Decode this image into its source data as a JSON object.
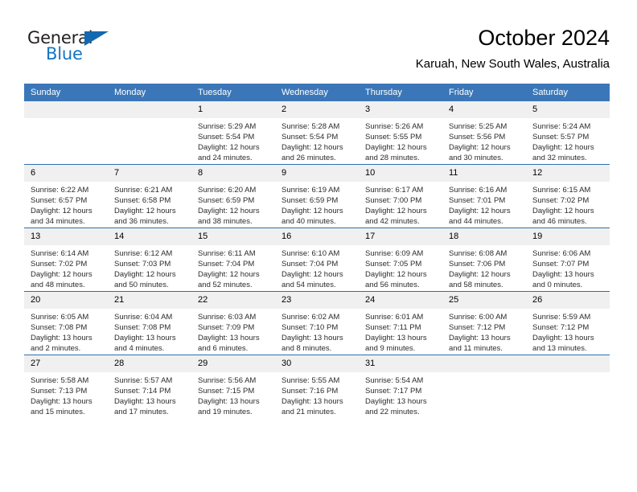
{
  "brand": {
    "name_part1": "General",
    "name_part2": "Blue",
    "triangle_icon": "triangle-icon",
    "accent_color": "#1474c4"
  },
  "header": {
    "title": "October 2024",
    "subtitle": "Karuah, New South Wales, Australia"
  },
  "calendar": {
    "header_bg": "#3b77b8",
    "daynum_bg": "#f0f0f0",
    "row_separator_color": "#2f6fae",
    "weekday_headers": [
      "Sunday",
      "Monday",
      "Tuesday",
      "Wednesday",
      "Thursday",
      "Friday",
      "Saturday"
    ],
    "weeks": [
      [
        {
          "day": "",
          "sunrise": "",
          "sunset": "",
          "daylight1": "",
          "daylight2": ""
        },
        {
          "day": "",
          "sunrise": "",
          "sunset": "",
          "daylight1": "",
          "daylight2": ""
        },
        {
          "day": "1",
          "sunrise": "Sunrise: 5:29 AM",
          "sunset": "Sunset: 5:54 PM",
          "daylight1": "Daylight: 12 hours",
          "daylight2": "and 24 minutes."
        },
        {
          "day": "2",
          "sunrise": "Sunrise: 5:28 AM",
          "sunset": "Sunset: 5:54 PM",
          "daylight1": "Daylight: 12 hours",
          "daylight2": "and 26 minutes."
        },
        {
          "day": "3",
          "sunrise": "Sunrise: 5:26 AM",
          "sunset": "Sunset: 5:55 PM",
          "daylight1": "Daylight: 12 hours",
          "daylight2": "and 28 minutes."
        },
        {
          "day": "4",
          "sunrise": "Sunrise: 5:25 AM",
          "sunset": "Sunset: 5:56 PM",
          "daylight1": "Daylight: 12 hours",
          "daylight2": "and 30 minutes."
        },
        {
          "day": "5",
          "sunrise": "Sunrise: 5:24 AM",
          "sunset": "Sunset: 5:57 PM",
          "daylight1": "Daylight: 12 hours",
          "daylight2": "and 32 minutes."
        }
      ],
      [
        {
          "day": "6",
          "sunrise": "Sunrise: 6:22 AM",
          "sunset": "Sunset: 6:57 PM",
          "daylight1": "Daylight: 12 hours",
          "daylight2": "and 34 minutes."
        },
        {
          "day": "7",
          "sunrise": "Sunrise: 6:21 AM",
          "sunset": "Sunset: 6:58 PM",
          "daylight1": "Daylight: 12 hours",
          "daylight2": "and 36 minutes."
        },
        {
          "day": "8",
          "sunrise": "Sunrise: 6:20 AM",
          "sunset": "Sunset: 6:59 PM",
          "daylight1": "Daylight: 12 hours",
          "daylight2": "and 38 minutes."
        },
        {
          "day": "9",
          "sunrise": "Sunrise: 6:19 AM",
          "sunset": "Sunset: 6:59 PM",
          "daylight1": "Daylight: 12 hours",
          "daylight2": "and 40 minutes."
        },
        {
          "day": "10",
          "sunrise": "Sunrise: 6:17 AM",
          "sunset": "Sunset: 7:00 PM",
          "daylight1": "Daylight: 12 hours",
          "daylight2": "and 42 minutes."
        },
        {
          "day": "11",
          "sunrise": "Sunrise: 6:16 AM",
          "sunset": "Sunset: 7:01 PM",
          "daylight1": "Daylight: 12 hours",
          "daylight2": "and 44 minutes."
        },
        {
          "day": "12",
          "sunrise": "Sunrise: 6:15 AM",
          "sunset": "Sunset: 7:02 PM",
          "daylight1": "Daylight: 12 hours",
          "daylight2": "and 46 minutes."
        }
      ],
      [
        {
          "day": "13",
          "sunrise": "Sunrise: 6:14 AM",
          "sunset": "Sunset: 7:02 PM",
          "daylight1": "Daylight: 12 hours",
          "daylight2": "and 48 minutes."
        },
        {
          "day": "14",
          "sunrise": "Sunrise: 6:12 AM",
          "sunset": "Sunset: 7:03 PM",
          "daylight1": "Daylight: 12 hours",
          "daylight2": "and 50 minutes."
        },
        {
          "day": "15",
          "sunrise": "Sunrise: 6:11 AM",
          "sunset": "Sunset: 7:04 PM",
          "daylight1": "Daylight: 12 hours",
          "daylight2": "and 52 minutes."
        },
        {
          "day": "16",
          "sunrise": "Sunrise: 6:10 AM",
          "sunset": "Sunset: 7:04 PM",
          "daylight1": "Daylight: 12 hours",
          "daylight2": "and 54 minutes."
        },
        {
          "day": "17",
          "sunrise": "Sunrise: 6:09 AM",
          "sunset": "Sunset: 7:05 PM",
          "daylight1": "Daylight: 12 hours",
          "daylight2": "and 56 minutes."
        },
        {
          "day": "18",
          "sunrise": "Sunrise: 6:08 AM",
          "sunset": "Sunset: 7:06 PM",
          "daylight1": "Daylight: 12 hours",
          "daylight2": "and 58 minutes."
        },
        {
          "day": "19",
          "sunrise": "Sunrise: 6:06 AM",
          "sunset": "Sunset: 7:07 PM",
          "daylight1": "Daylight: 13 hours",
          "daylight2": "and 0 minutes."
        }
      ],
      [
        {
          "day": "20",
          "sunrise": "Sunrise: 6:05 AM",
          "sunset": "Sunset: 7:08 PM",
          "daylight1": "Daylight: 13 hours",
          "daylight2": "and 2 minutes."
        },
        {
          "day": "21",
          "sunrise": "Sunrise: 6:04 AM",
          "sunset": "Sunset: 7:08 PM",
          "daylight1": "Daylight: 13 hours",
          "daylight2": "and 4 minutes."
        },
        {
          "day": "22",
          "sunrise": "Sunrise: 6:03 AM",
          "sunset": "Sunset: 7:09 PM",
          "daylight1": "Daylight: 13 hours",
          "daylight2": "and 6 minutes."
        },
        {
          "day": "23",
          "sunrise": "Sunrise: 6:02 AM",
          "sunset": "Sunset: 7:10 PM",
          "daylight1": "Daylight: 13 hours",
          "daylight2": "and 8 minutes."
        },
        {
          "day": "24",
          "sunrise": "Sunrise: 6:01 AM",
          "sunset": "Sunset: 7:11 PM",
          "daylight1": "Daylight: 13 hours",
          "daylight2": "and 9 minutes."
        },
        {
          "day": "25",
          "sunrise": "Sunrise: 6:00 AM",
          "sunset": "Sunset: 7:12 PM",
          "daylight1": "Daylight: 13 hours",
          "daylight2": "and 11 minutes."
        },
        {
          "day": "26",
          "sunrise": "Sunrise: 5:59 AM",
          "sunset": "Sunset: 7:12 PM",
          "daylight1": "Daylight: 13 hours",
          "daylight2": "and 13 minutes."
        }
      ],
      [
        {
          "day": "27",
          "sunrise": "Sunrise: 5:58 AM",
          "sunset": "Sunset: 7:13 PM",
          "daylight1": "Daylight: 13 hours",
          "daylight2": "and 15 minutes."
        },
        {
          "day": "28",
          "sunrise": "Sunrise: 5:57 AM",
          "sunset": "Sunset: 7:14 PM",
          "daylight1": "Daylight: 13 hours",
          "daylight2": "and 17 minutes."
        },
        {
          "day": "29",
          "sunrise": "Sunrise: 5:56 AM",
          "sunset": "Sunset: 7:15 PM",
          "daylight1": "Daylight: 13 hours",
          "daylight2": "and 19 minutes."
        },
        {
          "day": "30",
          "sunrise": "Sunrise: 5:55 AM",
          "sunset": "Sunset: 7:16 PM",
          "daylight1": "Daylight: 13 hours",
          "daylight2": "and 21 minutes."
        },
        {
          "day": "31",
          "sunrise": "Sunrise: 5:54 AM",
          "sunset": "Sunset: 7:17 PM",
          "daylight1": "Daylight: 13 hours",
          "daylight2": "and 22 minutes."
        },
        {
          "day": "",
          "sunrise": "",
          "sunset": "",
          "daylight1": "",
          "daylight2": ""
        },
        {
          "day": "",
          "sunrise": "",
          "sunset": "",
          "daylight1": "",
          "daylight2": ""
        }
      ]
    ]
  }
}
